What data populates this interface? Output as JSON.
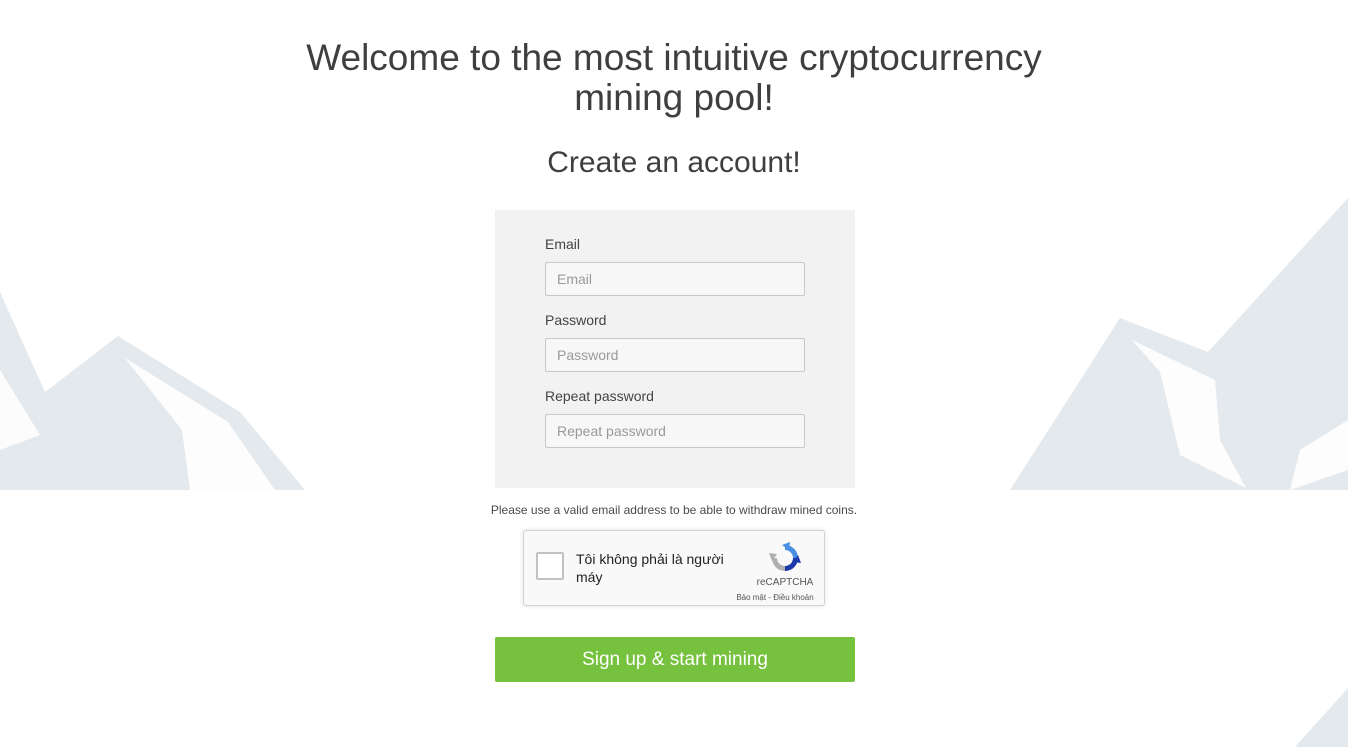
{
  "header": {
    "title_line1": "Welcome to the most intuitive cryptocurrency",
    "title_line2": "mining pool!",
    "subtitle": "Create an account!"
  },
  "form": {
    "email": {
      "label": "Email",
      "placeholder": "Email",
      "value": ""
    },
    "password": {
      "label": "Password",
      "placeholder": "Password",
      "value": ""
    },
    "repeat_password": {
      "label": "Repeat password",
      "placeholder": "Repeat password",
      "value": ""
    }
  },
  "note": "Please use a valid email address to be able to withdraw mined coins.",
  "captcha": {
    "label": "Tôi không phải là người máy",
    "brand": "reCAPTCHA",
    "links": "Bảo mật - Điều khoản",
    "checked": false,
    "icon": "recaptcha-icon"
  },
  "signup_button": {
    "label": "Sign up & start mining"
  },
  "colors": {
    "accent": "#76c13e",
    "card": "#f2f2f2",
    "mountains": "#e4e9ed"
  }
}
